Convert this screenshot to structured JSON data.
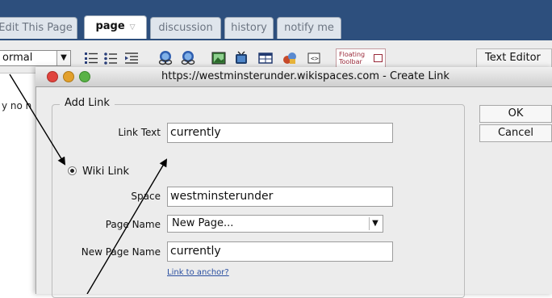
{
  "tabs": {
    "edit_this_page": "Edit This Page",
    "page": "page",
    "page_chevron": "▽",
    "discussion": "discussion",
    "history": "history",
    "notify_me": "notify me"
  },
  "toolbar": {
    "format_value": "ormal",
    "floating_toolbar_line1": "Floating",
    "floating_toolbar_line2": "Toolbar",
    "text_editor": "Text Editor",
    "icons": [
      "numbered-list-icon",
      "bullet-list-icon",
      "indent-icon",
      "link-icon",
      "unlink-icon",
      "image-icon",
      "video-icon",
      "table-icon",
      "widget-icon",
      "code-icon"
    ]
  },
  "background": {
    "text": "y no n"
  },
  "dialog": {
    "window_title": "https://westminsterunder.wikispaces.com - Create Link",
    "group_title": "Add Link",
    "link_text_label": "Link Text",
    "link_text_value": "currently",
    "wiki_link_label": "Wiki Link",
    "wiki_link_selected": true,
    "space_label": "Space",
    "space_value": "westminsterunder",
    "page_name_label": "Page Name",
    "page_name_value": "New Page...",
    "new_page_name_label": "New Page Name",
    "new_page_name_value": "currently",
    "link_to_anchor": "Link to anchor?",
    "ok_label": "OK",
    "cancel_label": "Cancel"
  },
  "colors": {
    "header_bg": "#2d4f7d",
    "close_light": "#e0443e",
    "minimize_light": "#e2a02c",
    "zoom_light": "#59b246",
    "link": "#2a4fa0"
  }
}
